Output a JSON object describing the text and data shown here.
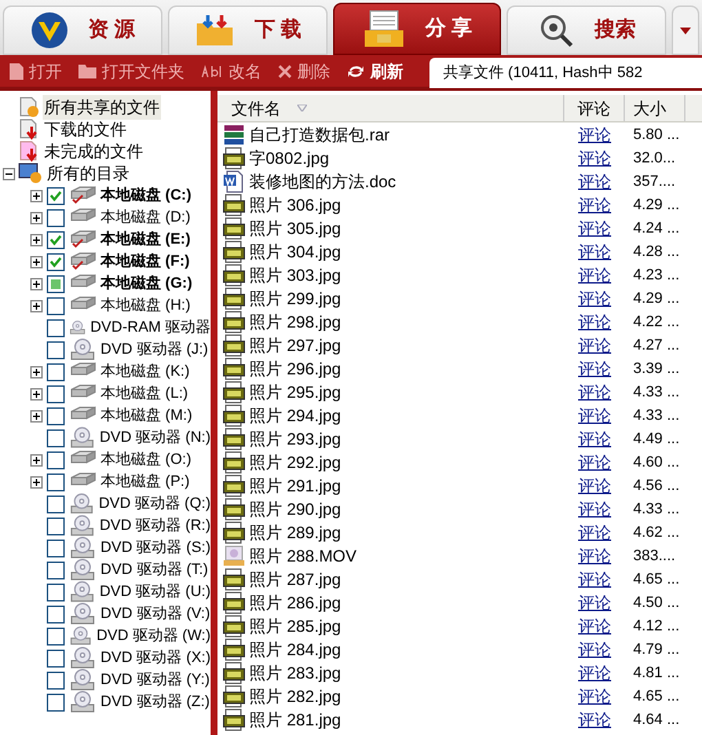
{
  "tabs": [
    {
      "label": "资 源",
      "kind": "resource",
      "selected": false
    },
    {
      "label": "下 载",
      "kind": "download",
      "selected": false
    },
    {
      "label": "分 享",
      "kind": "share",
      "selected": true
    },
    {
      "label": "搜索",
      "kind": "search",
      "selected": false
    }
  ],
  "toolbar": [
    {
      "label": "打开",
      "kind": "open",
      "disabled": true
    },
    {
      "label": "打开文件夹",
      "kind": "folder",
      "disabled": true
    },
    {
      "label": "改名",
      "kind": "rename",
      "disabled": true
    },
    {
      "label": "删除",
      "kind": "delete",
      "disabled": true
    },
    {
      "label": "刷新",
      "kind": "refresh",
      "disabled": false
    }
  ],
  "status": "共享文件 (10411, Hash中 582",
  "tree": [
    {
      "label": "所有共享的文件",
      "kind": "shared",
      "selected": true
    },
    {
      "label": "下载的文件",
      "kind": "downloaded",
      "selected": false
    },
    {
      "label": "未完成的文件",
      "kind": "incomplete",
      "selected": false
    },
    {
      "label": "所有的目录",
      "kind": "all",
      "selected": false,
      "expanded": true,
      "children": [
        {
          "label": "本地磁盘 (C:)",
          "kind": "disk",
          "expandable": true,
          "checked": true,
          "partial": false
        },
        {
          "label": "本地磁盘 (D:)",
          "kind": "disk",
          "expandable": true,
          "checked": false,
          "partial": false
        },
        {
          "label": "本地磁盘 (E:)",
          "kind": "disk",
          "expandable": true,
          "checked": true,
          "partial": false
        },
        {
          "label": "本地磁盘 (F:)",
          "kind": "disk",
          "expandable": true,
          "checked": true,
          "partial": false
        },
        {
          "label": "本地磁盘 (G:)",
          "kind": "disk",
          "expandable": true,
          "checked": false,
          "partial": true
        },
        {
          "label": "本地磁盘 (H:)",
          "kind": "disk",
          "expandable": true,
          "checked": false,
          "partial": false
        },
        {
          "label": "DVD-RAM 驱动器",
          "kind": "dvd",
          "expandable": false,
          "checked": false,
          "partial": false
        },
        {
          "label": "DVD 驱动器 (J:)",
          "kind": "dvd",
          "expandable": false,
          "checked": false,
          "partial": false
        },
        {
          "label": "本地磁盘 (K:)",
          "kind": "disk",
          "expandable": true,
          "checked": false,
          "partial": false
        },
        {
          "label": "本地磁盘 (L:)",
          "kind": "disk",
          "expandable": true,
          "checked": false,
          "partial": false
        },
        {
          "label": "本地磁盘 (M:)",
          "kind": "disk",
          "expandable": true,
          "checked": false,
          "partial": false
        },
        {
          "label": "DVD 驱动器 (N:)",
          "kind": "dvd",
          "expandable": false,
          "checked": false,
          "partial": false
        },
        {
          "label": "本地磁盘 (O:)",
          "kind": "disk",
          "expandable": true,
          "checked": false,
          "partial": false
        },
        {
          "label": "本地磁盘 (P:)",
          "kind": "disk",
          "expandable": true,
          "checked": false,
          "partial": false
        },
        {
          "label": "DVD 驱动器 (Q:)",
          "kind": "dvd",
          "expandable": false,
          "checked": false,
          "partial": false
        },
        {
          "label": "DVD 驱动器 (R:)",
          "kind": "dvd",
          "expandable": false,
          "checked": false,
          "partial": false
        },
        {
          "label": "DVD 驱动器 (S:)",
          "kind": "dvd",
          "expandable": false,
          "checked": false,
          "partial": false
        },
        {
          "label": "DVD 驱动器 (T:)",
          "kind": "dvd",
          "expandable": false,
          "checked": false,
          "partial": false
        },
        {
          "label": "DVD 驱动器 (U:)",
          "kind": "dvd",
          "expandable": false,
          "checked": false,
          "partial": false
        },
        {
          "label": "DVD 驱动器 (V:)",
          "kind": "dvd",
          "expandable": false,
          "checked": false,
          "partial": false
        },
        {
          "label": "DVD 驱动器 (W:)",
          "kind": "dvd",
          "expandable": false,
          "checked": false,
          "partial": false
        },
        {
          "label": "DVD 驱动器 (X:)",
          "kind": "dvd",
          "expandable": false,
          "checked": false,
          "partial": false
        },
        {
          "label": "DVD 驱动器 (Y:)",
          "kind": "dvd",
          "expandable": false,
          "checked": false,
          "partial": false
        },
        {
          "label": "DVD 驱动器 (Z:)",
          "kind": "dvd",
          "expandable": false,
          "checked": false,
          "partial": false
        }
      ]
    }
  ],
  "table": {
    "columns": [
      "文件名",
      "评论",
      "大小"
    ],
    "rows": [
      {
        "name": "自己打造数据包.rar",
        "kind": "rar",
        "comment": "评论",
        "size": "5.80 ..."
      },
      {
        "name": "字0802.jpg",
        "kind": "jpg",
        "comment": "评论",
        "size": "32.0..."
      },
      {
        "name": "装修地图的方法.doc",
        "kind": "doc",
        "comment": "评论",
        "size": "357...."
      },
      {
        "name": "照片 306.jpg",
        "kind": "jpg",
        "comment": "评论",
        "size": "4.29 ..."
      },
      {
        "name": "照片 305.jpg",
        "kind": "jpg",
        "comment": "评论",
        "size": "4.24 ..."
      },
      {
        "name": "照片 304.jpg",
        "kind": "jpg",
        "comment": "评论",
        "size": "4.28 ..."
      },
      {
        "name": "照片 303.jpg",
        "kind": "jpg",
        "comment": "评论",
        "size": "4.23 ..."
      },
      {
        "name": "照片 299.jpg",
        "kind": "jpg",
        "comment": "评论",
        "size": "4.29 ..."
      },
      {
        "name": "照片 298.jpg",
        "kind": "jpg",
        "comment": "评论",
        "size": "4.22 ..."
      },
      {
        "name": "照片 297.jpg",
        "kind": "jpg",
        "comment": "评论",
        "size": "4.27 ..."
      },
      {
        "name": "照片 296.jpg",
        "kind": "jpg",
        "comment": "评论",
        "size": "3.39 ..."
      },
      {
        "name": "照片 295.jpg",
        "kind": "jpg",
        "comment": "评论",
        "size": "4.33 ..."
      },
      {
        "name": "照片 294.jpg",
        "kind": "jpg",
        "comment": "评论",
        "size": "4.33 ..."
      },
      {
        "name": "照片 293.jpg",
        "kind": "jpg",
        "comment": "评论",
        "size": "4.49 ..."
      },
      {
        "name": "照片 292.jpg",
        "kind": "jpg",
        "comment": "评论",
        "size": "4.60 ..."
      },
      {
        "name": "照片 291.jpg",
        "kind": "jpg",
        "comment": "评论",
        "size": "4.56 ..."
      },
      {
        "name": "照片 290.jpg",
        "kind": "jpg",
        "comment": "评论",
        "size": "4.33 ..."
      },
      {
        "name": "照片 289.jpg",
        "kind": "jpg",
        "comment": "评论",
        "size": "4.62 ..."
      },
      {
        "name": "照片 288.MOV",
        "kind": "mov",
        "comment": "评论",
        "size": "383...."
      },
      {
        "name": "照片 287.jpg",
        "kind": "jpg",
        "comment": "评论",
        "size": "4.65 ..."
      },
      {
        "name": "照片 286.jpg",
        "kind": "jpg",
        "comment": "评论",
        "size": "4.50 ..."
      },
      {
        "name": "照片 285.jpg",
        "kind": "jpg",
        "comment": "评论",
        "size": "4.12 ..."
      },
      {
        "name": "照片 284.jpg",
        "kind": "jpg",
        "comment": "评论",
        "size": "4.79 ..."
      },
      {
        "name": "照片 283.jpg",
        "kind": "jpg",
        "comment": "评论",
        "size": "4.81 ..."
      },
      {
        "name": "照片 282.jpg",
        "kind": "jpg",
        "comment": "评论",
        "size": "4.65 ..."
      },
      {
        "name": "照片 281.jpg",
        "kind": "jpg",
        "comment": "评论",
        "size": "4.64 ..."
      }
    ]
  }
}
